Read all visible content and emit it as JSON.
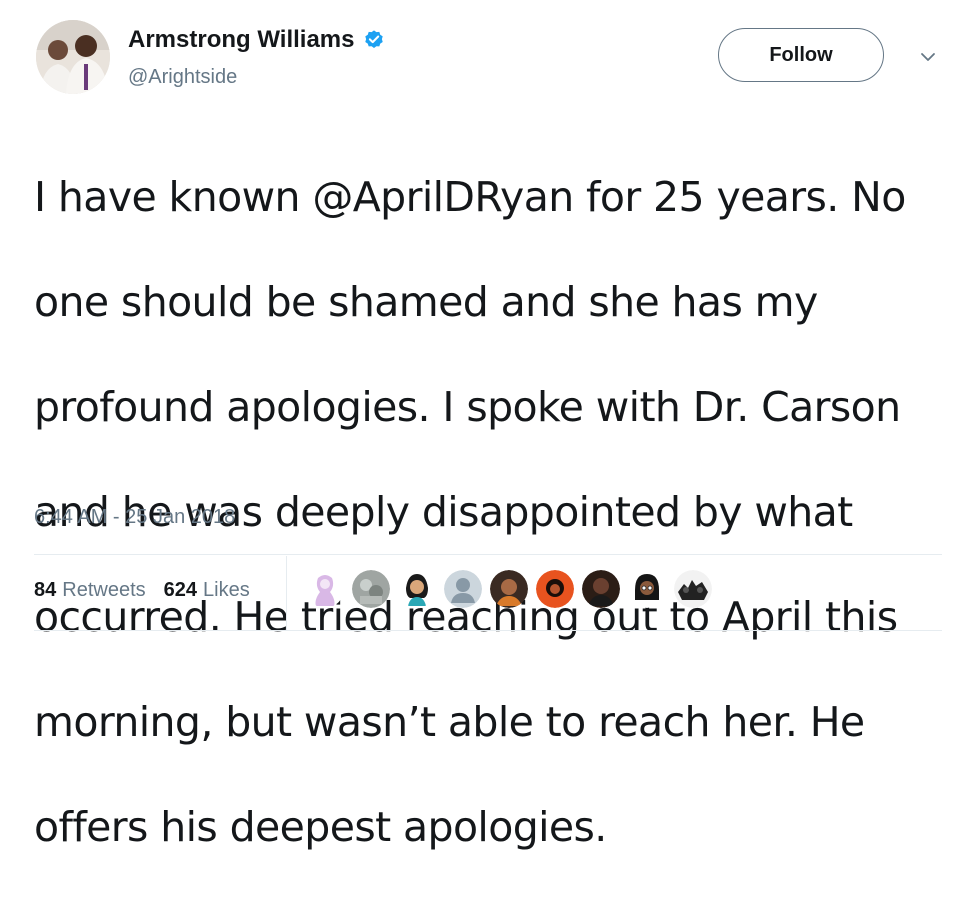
{
  "user": {
    "display_name": "Armstrong Williams",
    "handle": "@Arightside",
    "verified": true
  },
  "actions": {
    "follow_label": "Follow"
  },
  "tweet": {
    "lines": [
      "I have known @AprilDRyan for 25 years. No",
      "one should be shamed and she has my",
      "profound apologies. I spoke with Dr. Carson",
      "and he was deeply disappointed by what",
      "occurred. He tried reaching out to April this",
      "morning, but wasn’t able to reach her. He",
      "offers his deepest apologies."
    ],
    "timestamp": "6:44 AM - 25 Jan 2018"
  },
  "stats": {
    "retweets_count": "84",
    "retweets_label": "Retweets",
    "likes_count": "624",
    "likes_label": "Likes"
  },
  "colors": {
    "verified_blue": "#1da1f2",
    "secondary_text": "#657786",
    "primary_text": "#14171a",
    "border": "#e6ecf0"
  },
  "icons": {
    "verified": "verified-badge-icon",
    "caret": "chevron-down-icon"
  }
}
